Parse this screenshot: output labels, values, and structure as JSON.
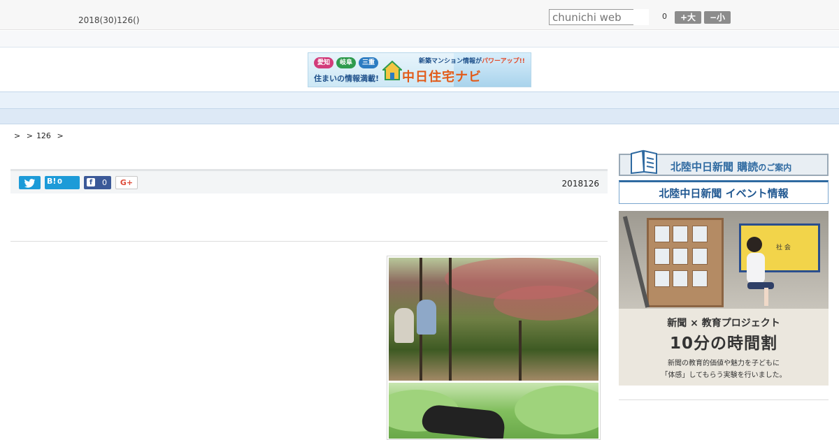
{
  "header": {
    "date": "2018(30)126()",
    "search_placeholder": "chunichi web",
    "font_count": "0",
    "font_large_label": "+大",
    "font_small_label": "−小"
  },
  "banner": {
    "tag_aichi": "愛知",
    "tag_gifu": "岐阜",
    "tag_mie": "三重",
    "subtitle": "住まいの情報満載!",
    "logo": "中日住宅ナビ",
    "headline_prefix": "新築マンション情報が",
    "headline_highlight": "パワーアップ!!"
  },
  "nav": {
    "items": [
      "",
      "",
      "",
      "",
      "",
      "",
      "",
      "",
      ""
    ]
  },
  "breadcrumb": {
    "items": [
      ">",
      ">",
      "126",
      ">"
    ]
  },
  "article": {
    "share_hatena_label": "B!",
    "share_hatena_count": "0",
    "share_facebook_count": "0",
    "share_gplus_label": "G+",
    "date": "2018126"
  },
  "sidebar": {
    "subscribe_ad_main": "北陸中日新聞 購読",
    "subscribe_ad_suffix": "のご案内",
    "event_ad": "北陸中日新聞 イベント情報",
    "edu_ad": {
      "screen_label": "社 会",
      "line1": "新聞 × 教育プロジェクト",
      "line2": "10分の時間割",
      "line3": "新聞の教育的価値や魅力を子どもに",
      "line4": "「体感」してもらう実験を行いました。"
    }
  },
  "colors": {
    "accent_blue": "#1d9bd8",
    "facebook_blue": "#3b5998",
    "nav_bg": "#e8f1fa",
    "font_button_gray": "#8c8c8c"
  }
}
